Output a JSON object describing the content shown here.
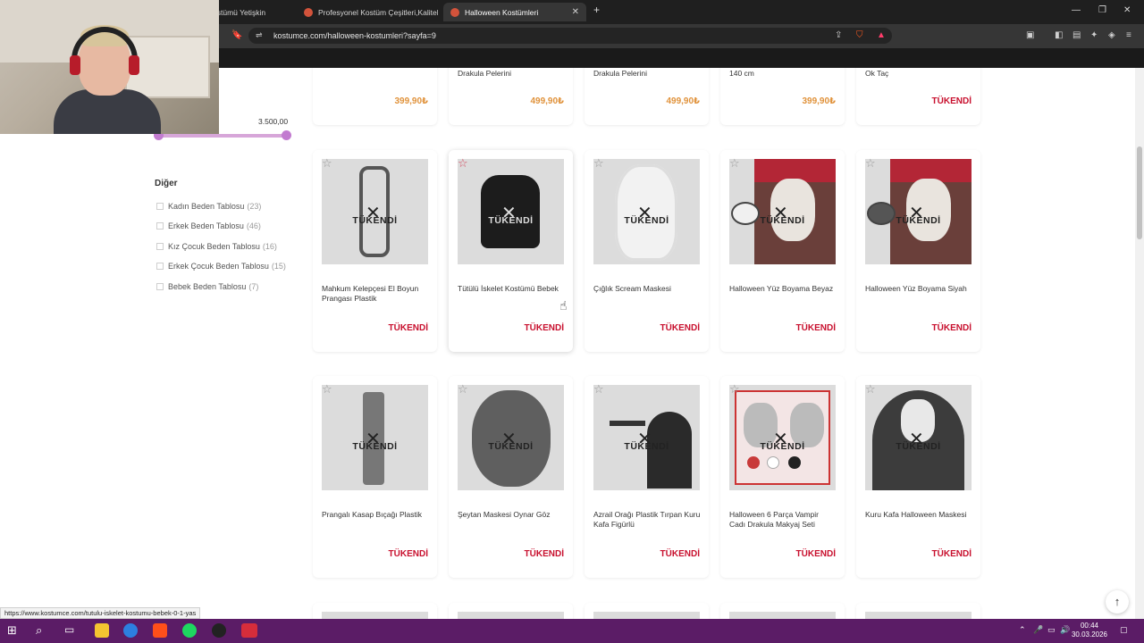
{
  "browser": {
    "tabs": [
      {
        "label": "ostümü Yetişkin",
        "active": false
      },
      {
        "label": "Profesyonel Kostüm Çeşitleri,Kaliteli ⁠",
        "active": false
      },
      {
        "label": "Halloween Kostümleri",
        "active": true
      }
    ],
    "new_tab": "+",
    "close": "✕",
    "url": "kostumce.com/halloween-kostumleri?sayfa=9",
    "window_controls": {
      "minimize": "—",
      "restore": "❐",
      "close": "✕"
    }
  },
  "sidebar": {
    "price_max": "3.500,00",
    "filter_title": "Diğer",
    "filters": [
      {
        "label": "Kadın Beden Tablosu",
        "count": "(23)"
      },
      {
        "label": "Erkek Beden Tablosu",
        "count": "(46)"
      },
      {
        "label": "Kız Çocuk Beden Tablosu",
        "count": "(16)"
      },
      {
        "label": "Erkek Çocuk Beden Tablosu",
        "count": "(15)"
      },
      {
        "label": "Bebek Beden Tablosu",
        "count": "(7)"
      }
    ]
  },
  "products_top": [
    {
      "name": "",
      "price": "399,90₺"
    },
    {
      "name": "Drakula Pelerini",
      "price": "499,90₺"
    },
    {
      "name": "Drakula Pelerini",
      "price": "499,90₺"
    },
    {
      "name": "140 cm",
      "price": "399,90₺"
    },
    {
      "name": "Ok Taç",
      "status": "TÜKENDİ"
    }
  ],
  "products_row1": [
    {
      "name": "Mahkum Kelepçesi El Boyun Prangası Plastik",
      "sold": "TÜKENDİ",
      "status": "TÜKENDİ",
      "favorite": false
    },
    {
      "name": "Tütülü İskelet Kostümü Bebek",
      "sold": "TÜKENDİ",
      "status": "TÜKENDİ",
      "favorite": true
    },
    {
      "name": "Çığlık Scream Maskesi",
      "sold": "TÜKENDİ",
      "status": "TÜKENDİ",
      "favorite": false
    },
    {
      "name": "Halloween Yüz Boyama Beyaz",
      "sold": "TÜKENDİ",
      "status": "TÜKENDİ",
      "favorite": false
    },
    {
      "name": "Halloween Yüz Boyama Siyah",
      "sold": "TÜKENDİ",
      "status": "TÜKENDİ",
      "favorite": false
    }
  ],
  "products_row2": [
    {
      "name": "Prangalı Kasap Bıçağı Plastik",
      "sold": "TÜKENDİ",
      "status": "TÜKENDİ"
    },
    {
      "name": "Şeytan Maskesi Oynar Göz",
      "sold": "TÜKENDİ",
      "status": "TÜKENDİ"
    },
    {
      "name": "Azrail Orağı Plastik Tırpan Kuru Kafa Figürlü",
      "sold": "TÜKENDİ",
      "status": "TÜKENDİ"
    },
    {
      "name": "Halloween 6 Parça Vampir Cadı Drakula Makyaj Seti",
      "sold": "TÜKENDİ",
      "status": "TÜKENDİ"
    },
    {
      "name": "Kuru Kafa Halloween Maskesi",
      "sold": "TÜKENDİ",
      "status": "TÜKENDİ"
    }
  ],
  "status_bar_url": "https://www.kostumce.com/tutulu-iskelet-kostumu-bebek-0-1-yas",
  "taskbar": {
    "time": "00:44",
    "date": "30.03.2026"
  },
  "icons": {
    "favorite": "star-icon",
    "sold_out": "cross-icon",
    "scroll_top": "arrow-up-icon",
    "windows": "windows-icon",
    "search": "search-icon"
  },
  "colors": {
    "sold_out": "#c8102e",
    "price": "#e0923b",
    "accent": "#c27bd0",
    "taskbar": "#5b1c66"
  }
}
